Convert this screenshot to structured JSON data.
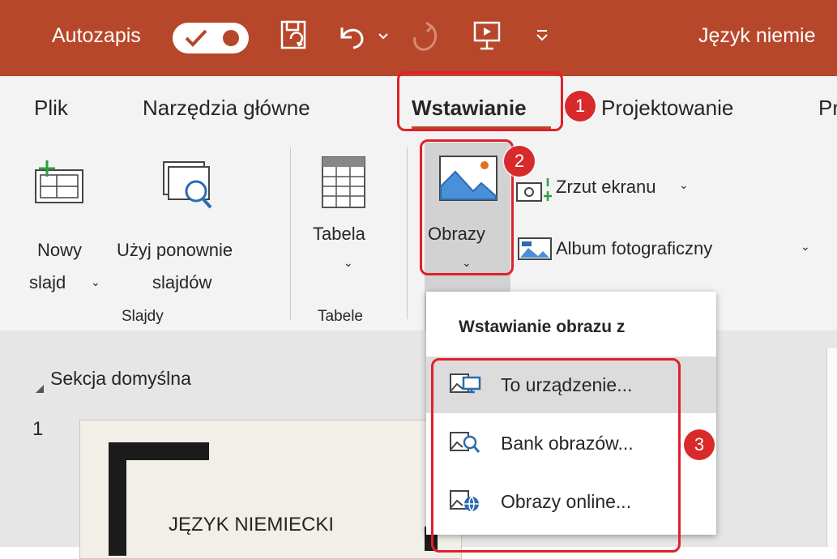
{
  "titlebar": {
    "autosave_label": "Autozapis",
    "doc_title": "Język niemie",
    "bg_color": "#b7472a"
  },
  "tabs": [
    {
      "label": "Plik"
    },
    {
      "label": "Narzędzia główne"
    },
    {
      "label": "Wstawianie"
    },
    {
      "label": "Projektowanie"
    },
    {
      "label": "Pr"
    }
  ],
  "ribbon": {
    "new_slide_line1": "Nowy",
    "new_slide_line2": "slajd",
    "reuse_line1": "Użyj ponownie",
    "reuse_line2": "slajdów",
    "group_slides": "Slajdy",
    "table": "Tabela",
    "group_tables": "Tabele",
    "images": "Obrazy",
    "screenshot": "Zrzut ekranu",
    "photo_album": "Album fotograficzny"
  },
  "dropdown": {
    "header": "Wstawianie obrazu z",
    "items": [
      {
        "label": "To urządzenie...",
        "icon": "device-image-icon"
      },
      {
        "label": "Bank obrazów...",
        "icon": "stock-images-icon"
      },
      {
        "label": "Obrazy online...",
        "icon": "online-images-icon"
      }
    ]
  },
  "slides_pane": {
    "section": "Sekcja domyślna",
    "slide_number": "1",
    "slide_title": "JĘZYK NIEMIECKI"
  },
  "annotations": {
    "badge1": "1",
    "badge2": "2",
    "badge3": "3",
    "color": "#e0202a"
  }
}
